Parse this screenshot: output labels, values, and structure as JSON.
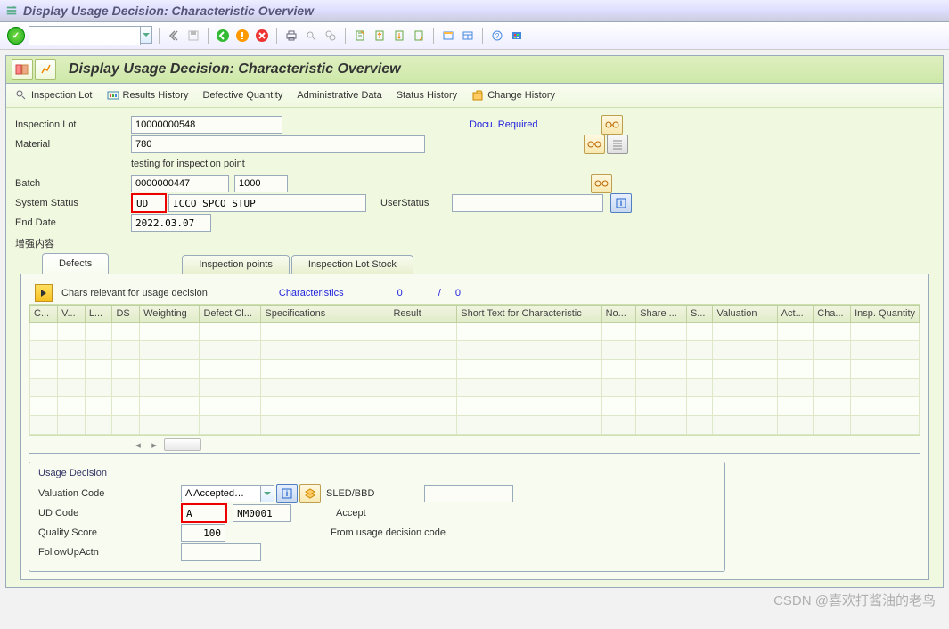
{
  "window": {
    "title": "Display Usage Decision: Characteristic Overview"
  },
  "screen": {
    "title": "Display Usage Decision: Characteristic Overview"
  },
  "apptoolbar": {
    "inspection_lot": "Inspection Lot",
    "results_history": "Results History",
    "defective_quantity": "Defective Quantity",
    "admin_data": "Administrative Data",
    "status_history": "Status History",
    "change_history": "Change History"
  },
  "form": {
    "inspection_lot_label": "Inspection Lot",
    "inspection_lot": "10000000548",
    "material_label": "Material",
    "material": "780",
    "material_desc": "testing for inspection point",
    "docu_required": "Docu. Required",
    "batch_label": "Batch",
    "batch": "0000000447",
    "batch_qty": "1000",
    "system_status_label": "System Status",
    "system_status_1": "UD",
    "system_status_2": "ICCO SPCO STUP",
    "user_status_label": "UserStatus",
    "user_status": "",
    "end_date_label": "End Date",
    "end_date": "2022.03.07",
    "enhancement_label": "增强内容"
  },
  "tabs": {
    "defects": "Defects",
    "inspection_points": "Inspection points",
    "inspection_lot_stock": "Inspection Lot Stock"
  },
  "grid": {
    "chars_relevant": "Chars relevant for usage decision",
    "characteristics_link": "Characteristics",
    "count_current": "0",
    "count_sep": "/",
    "count_total": "0",
    "cols": {
      "c": "C...",
      "v": "V...",
      "l": "L...",
      "ds": "DS",
      "weighting": "Weighting",
      "defect_cl": "Defect Cl...",
      "specifications": "Specifications",
      "result": "Result",
      "short_text": "Short Text for Characteristic",
      "no": "No...",
      "share": "Share ...",
      "s": "S...",
      "valuation": "Valuation",
      "act": "Act...",
      "cha": "Cha...",
      "insp_qty": "Insp. Quantity"
    }
  },
  "ud": {
    "group_title": "Usage Decision",
    "valuation_code_label": "Valuation Code",
    "valuation_code": "A Accepted…",
    "sled_label": "SLED/BBD",
    "sled": "",
    "ud_code_label": "UD Code",
    "ud_code": "A",
    "ud_code2": "NM0001",
    "ud_text": "Accept",
    "quality_score_label": "Quality Score",
    "quality_score": "100",
    "quality_score_text": "From usage decision code",
    "followup_label": "FollowUpActn",
    "followup": ""
  },
  "watermark": "CSDN @喜欢打酱油的老鸟"
}
